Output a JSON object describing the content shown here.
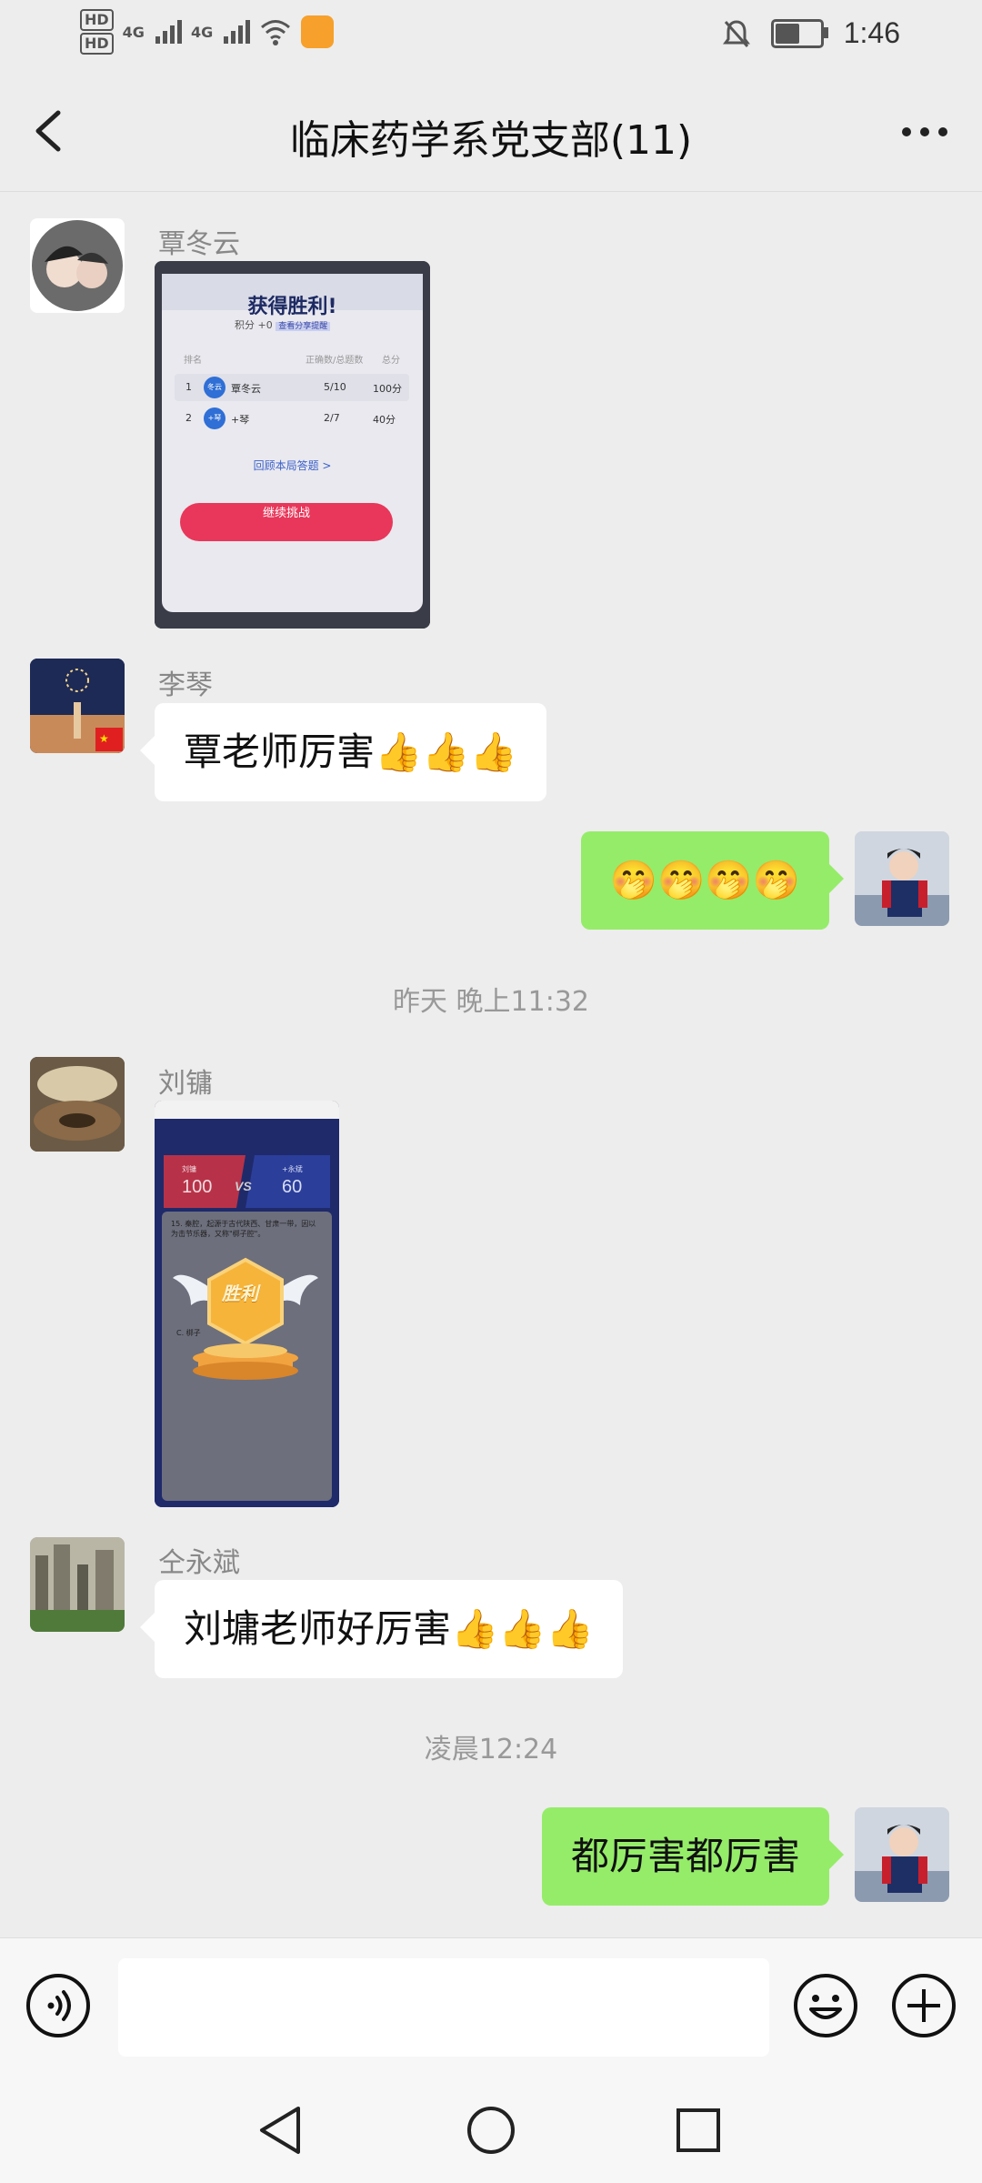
{
  "status_bar": {
    "hd1": "HD",
    "hd2": "HD",
    "signal1": "4G",
    "signal2": "4G",
    "time": "1:46",
    "battery_level": 0.6
  },
  "header": {
    "title": "临床药学系党支部(11)"
  },
  "messages": [
    {
      "sender": "覃冬云"
    },
    {
      "sender": "李琴",
      "text": "覃老师厉害👍👍👍"
    },
    {
      "text": "🤭🤭🤭🤭"
    },
    {
      "timestamp": "昨天 晚上11:32"
    },
    {
      "sender": "刘镛"
    },
    {
      "sender": "仝永斌",
      "text": "刘墉老师好厉害👍👍👍"
    },
    {
      "timestamp": "凌晨12:24"
    },
    {
      "text": "都厉害都厉害"
    }
  ],
  "image1": {
    "title": "获得胜利!",
    "score": "积分 +0",
    "score_tag": "查看分享提醒",
    "col_rank": "排名",
    "col_correct": "正确数/总题数",
    "col_points": "总分",
    "rows": [
      {
        "rank": "1",
        "avatar": "冬云",
        "name": "覃冬云",
        "correct": "5/10",
        "points": "100分"
      },
      {
        "rank": "2",
        "avatar": "+琴",
        "name": "+琴",
        "correct": "2/7",
        "points": "40分"
      }
    ],
    "review": "回顾本局答题 >",
    "continue": "继续挑战"
  },
  "image2": {
    "left_score": "100",
    "right_score": "60",
    "left_name": "刘镛",
    "right_name": "+永斌",
    "vs": "VS",
    "question": "15. 秦腔，起源于古代陕西、甘肃一带，因以　　为击节乐器，又称\"梆子腔\"。",
    "badge": "胜利",
    "option_c": "C. 梆子"
  },
  "colors": {
    "bg": "#ededed",
    "bubble_self": "#95ec69",
    "bubble_other": "#ffffff",
    "continue_button": "#e8375a",
    "image2_panel": "#1f2a6b"
  }
}
